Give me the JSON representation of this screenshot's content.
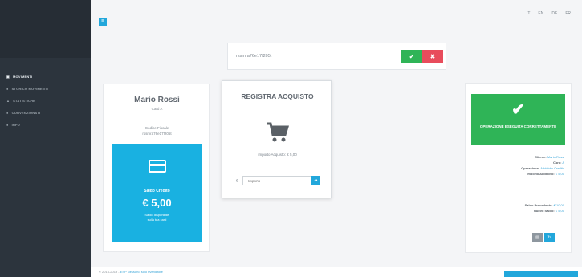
{
  "sidebar": {
    "items": [
      {
        "icon": "wallet-icon",
        "label": "MOVIMENTI",
        "active": true
      },
      {
        "icon": "list-icon",
        "label": "STORICO MOVIMENTI",
        "active": false
      },
      {
        "icon": "chart-icon",
        "label": "STATISTICHE",
        "active": false
      },
      {
        "icon": "users-icon",
        "label": "CONVENZIONATI",
        "active": false
      },
      {
        "icon": "info-icon",
        "label": "INFO",
        "active": false
      }
    ]
  },
  "topbar": {
    "menu_icon": "≡",
    "right_items": [
      "IT",
      "EN",
      "DE",
      "FR"
    ]
  },
  "search": {
    "value": "rssmra76e17f205t"
  },
  "customer": {
    "name": "Mario Rossi",
    "subtitle": "Card A",
    "cf_label": "Codice Fiscale",
    "cf_value": "rssmra76e17f205t",
    "credit_label": "Saldo Credito",
    "credit_value": "€ 5,00",
    "credit_note": "Saldo disponibile\nsulla tua card"
  },
  "register": {
    "title": "REGISTRA ACQUISTO",
    "text": "Importo Acquisto: € 5,00",
    "currency": "€",
    "input_placeholder": "Importo"
  },
  "result": {
    "message": "OPERAZIONE ESEGUITA CORRETTAMENTE",
    "lines": [
      {
        "label": "Cliente:",
        "value": "Mario Rossi"
      },
      {
        "label": "Card:",
        "value": "A"
      },
      {
        "label": "Operazione:",
        "value": "Addebito Credito"
      },
      {
        "label": "Importo Addebito:",
        "value": "€ 5,00"
      }
    ],
    "balance": [
      {
        "label": "Saldo Precedente:",
        "value": "€ 10,00"
      },
      {
        "label": "Nuovo Saldo:",
        "value": "€ 5,00"
      }
    ]
  },
  "footer": {
    "text": "© 2016-2019 -",
    "link": "ESP Nessuno solo rivenditore"
  },
  "colors": {
    "accent": "#22a7db",
    "success": "#2fb457",
    "danger": "#e84c5c",
    "sidebar": "#2c343d"
  }
}
